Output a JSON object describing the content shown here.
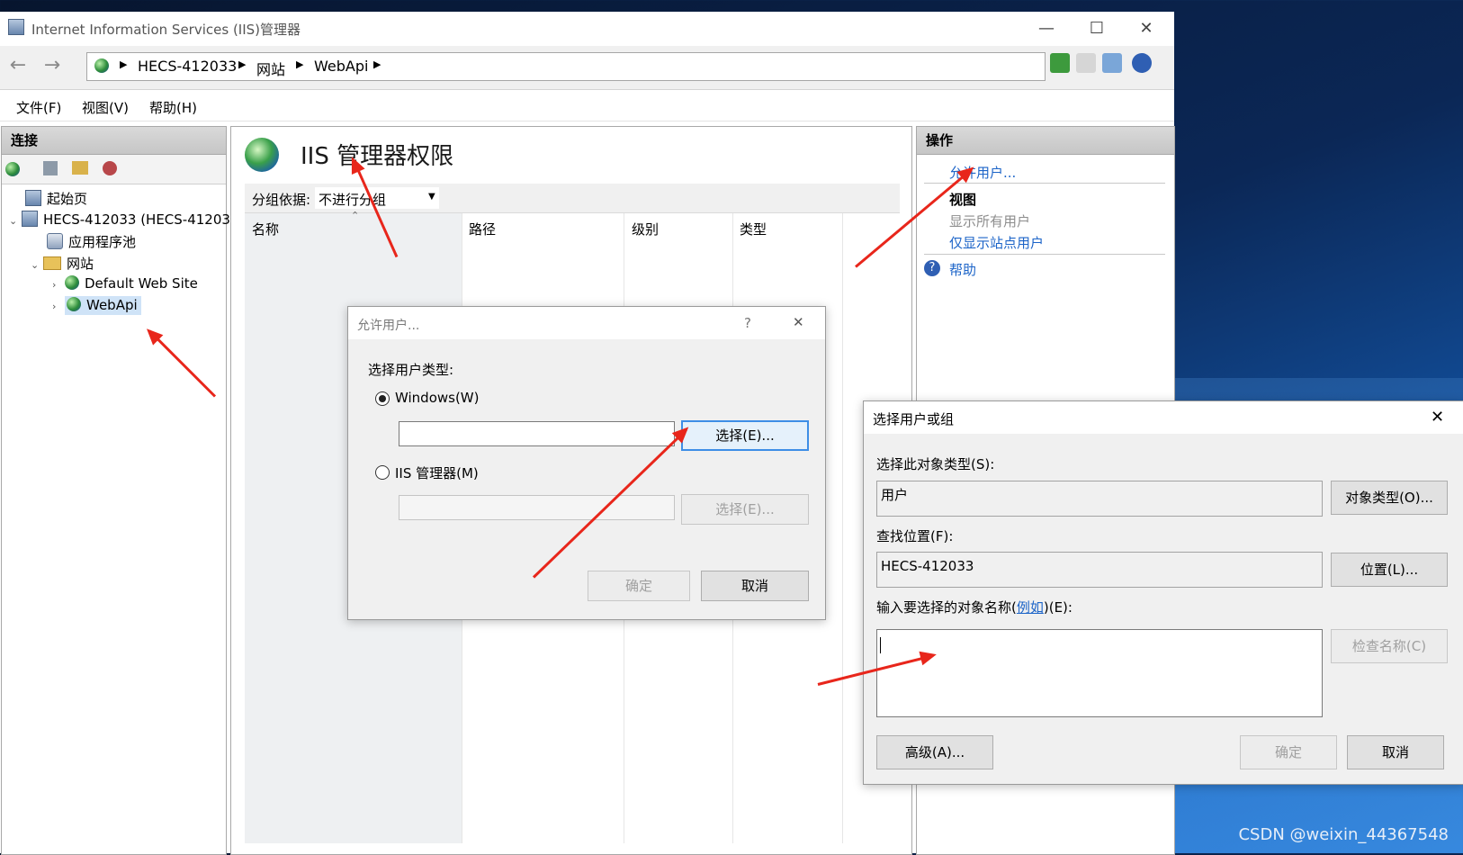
{
  "window": {
    "title": "Internet Information Services (IIS)管理器",
    "controls": {
      "minimize": "—",
      "maximize": "☐",
      "close": "✕"
    }
  },
  "address": {
    "crumbs": [
      "HECS-412033",
      "网站",
      "WebApi"
    ]
  },
  "menu": {
    "file": "文件(F)",
    "view": "视图(V)",
    "help": "帮助(H)"
  },
  "connections": {
    "header": "连接",
    "tree": {
      "start_page": "起始页",
      "server": "HECS-412033 (HECS-412033",
      "app_pools": "应用程序池",
      "sites": "网站",
      "default_site": "Default Web Site",
      "webapi": "WebApi"
    }
  },
  "main": {
    "title": "IIS 管理器权限",
    "group_label": "分组依据:",
    "group_value": "不进行分组",
    "columns": [
      "名称",
      "路径",
      "级别",
      "类型"
    ]
  },
  "actions": {
    "header": "操作",
    "allow_user": "允许用户...",
    "view_header": "视图",
    "show_all_users": "显示所有用户",
    "show_site_users": "仅显示站点用户",
    "help": "帮助"
  },
  "allow_dialog": {
    "title": "允许用户...",
    "help_glyph": "?",
    "close_glyph": "✕",
    "select_type_label": "选择用户类型:",
    "windows_option": "Windows(W)",
    "windows_value": "",
    "select_button": "选择(E)...",
    "iis_option": "IIS 管理器(M)",
    "iis_value": "",
    "select_button_disabled": "选择(E)...",
    "ok": "确定",
    "cancel": "取消"
  },
  "select_dialog": {
    "title": "选择用户或组",
    "close_glyph": "✕",
    "object_type_label": "选择此对象类型(S):",
    "object_type_value": "用户",
    "object_type_button": "对象类型(O)...",
    "location_label": "查找位置(F):",
    "location_value": "HECS-412033",
    "location_button": "位置(L)...",
    "names_label_prefix": "输入要选择的对象名称(",
    "names_label_link": "例如",
    "names_label_suffix": ")(E):",
    "names_value": "",
    "check_names_button": "检查名称(C)",
    "advanced_button": "高级(A)...",
    "ok": "确定",
    "cancel": "取消"
  },
  "watermark": "CSDN @weixin_44367548",
  "colors": {
    "arrow": "#e8261b",
    "link": "#1c64c8",
    "focus": "#3d8ee6"
  }
}
